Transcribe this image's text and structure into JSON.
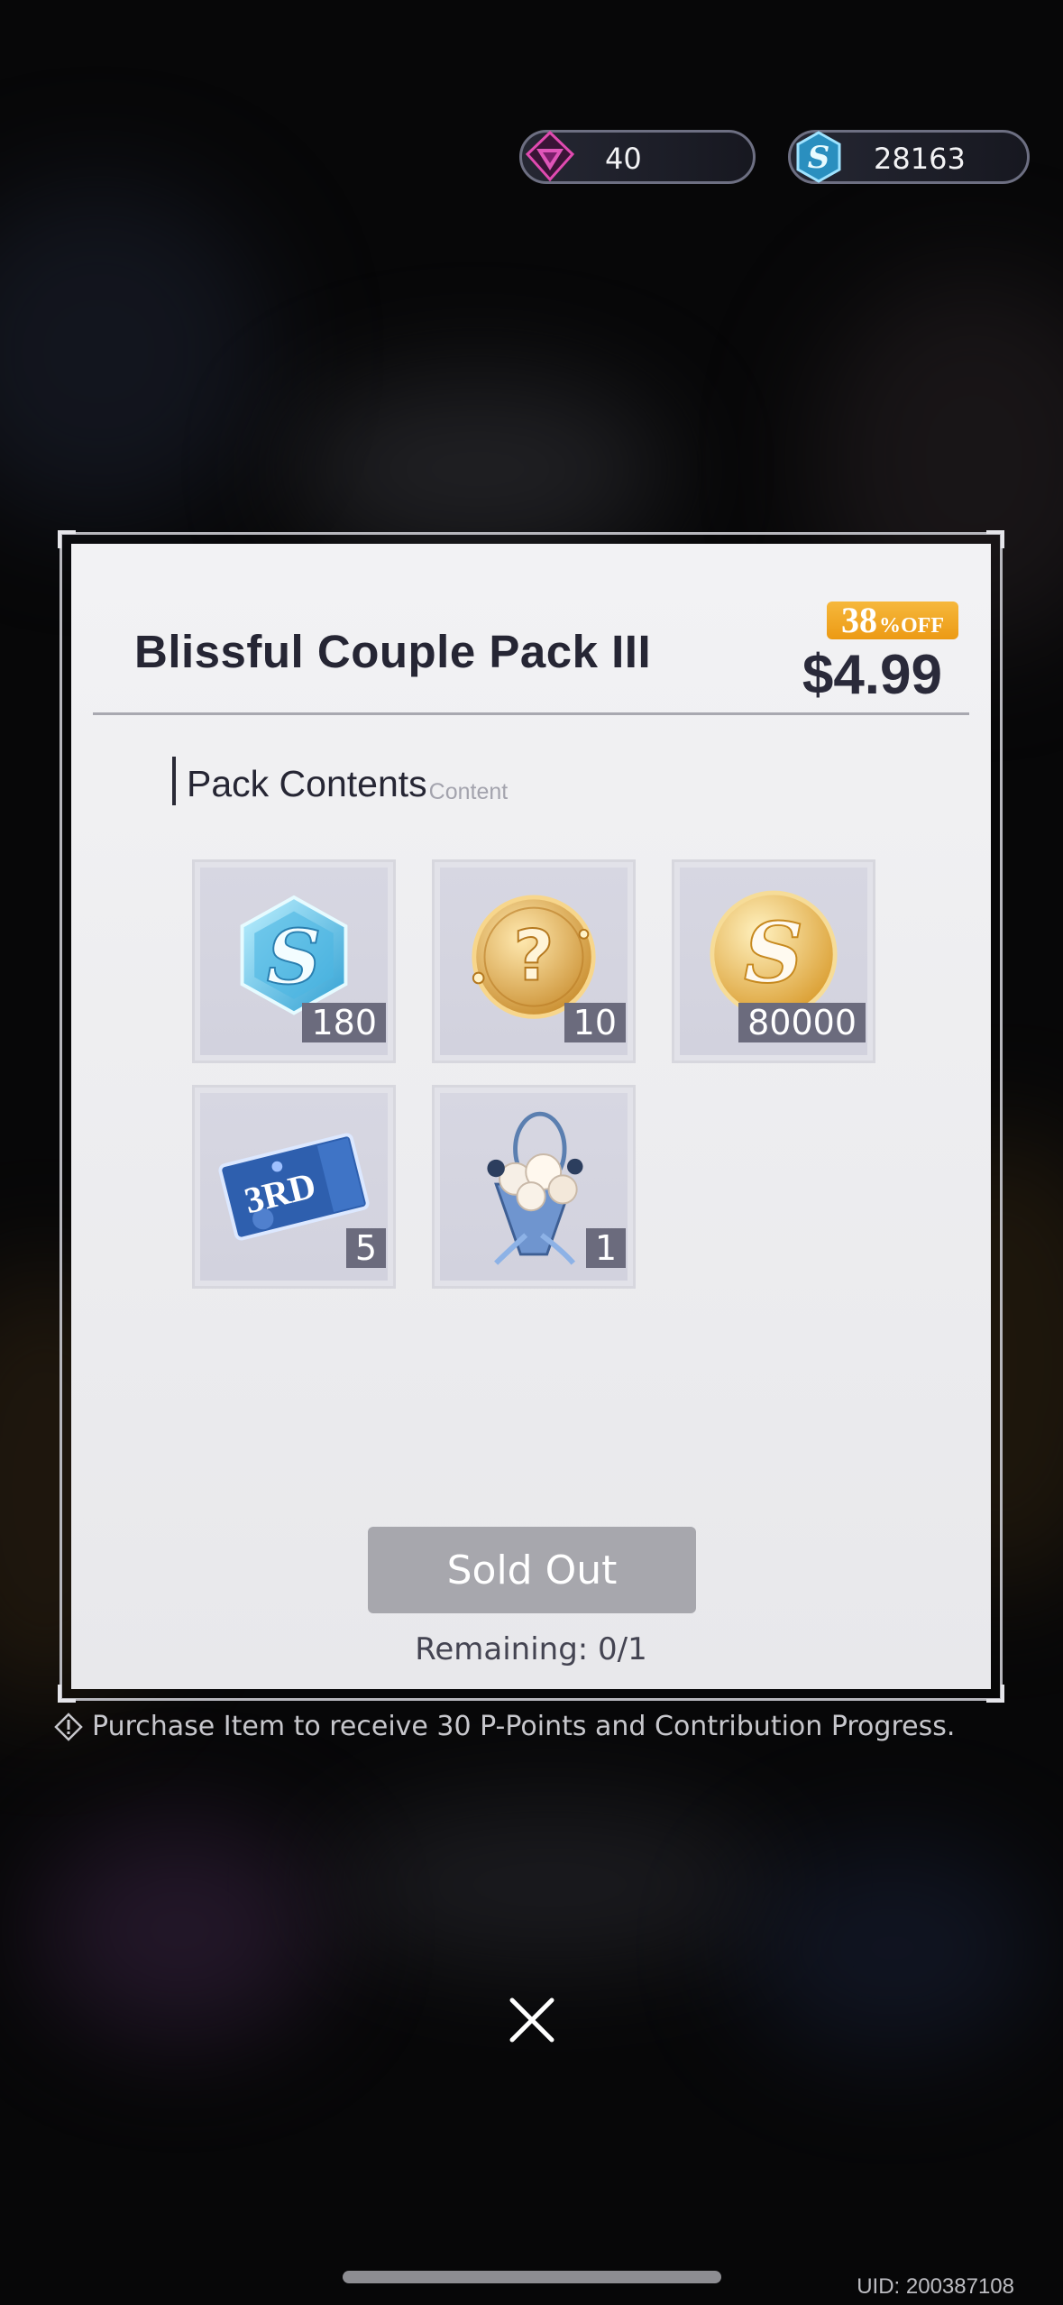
{
  "currencies": [
    {
      "icon": "gem-icon",
      "value": "40"
    },
    {
      "icon": "s-crystal-icon",
      "value": "28163"
    }
  ],
  "pack": {
    "title": "Blissful Couple Pack III",
    "discount_number": "38",
    "discount_suffix": "%OFF",
    "price": "$4.99",
    "section_title": "Pack Contents",
    "section_subtitle": "Content"
  },
  "items": [
    {
      "icon": "s-crystal-icon",
      "quantity": "180"
    },
    {
      "icon": "mystery-coin-icon",
      "quantity": "10"
    },
    {
      "icon": "gold-s-coin-icon",
      "quantity": "80000"
    },
    {
      "icon": "3rd-ticket-icon",
      "quantity": "5"
    },
    {
      "icon": "bouquet-icon",
      "quantity": "1"
    }
  ],
  "button": {
    "label": "Sold Out"
  },
  "remaining": "Remaining: 0/1",
  "notice": "Purchase Item to receive 30 P-Points and Contribution Progress.",
  "uid": "UID: 200387108",
  "colors": {
    "discount_badge": "#ef9f1c",
    "sold_out_button": "#a7a7ad",
    "panel": "#f0f0f2"
  }
}
